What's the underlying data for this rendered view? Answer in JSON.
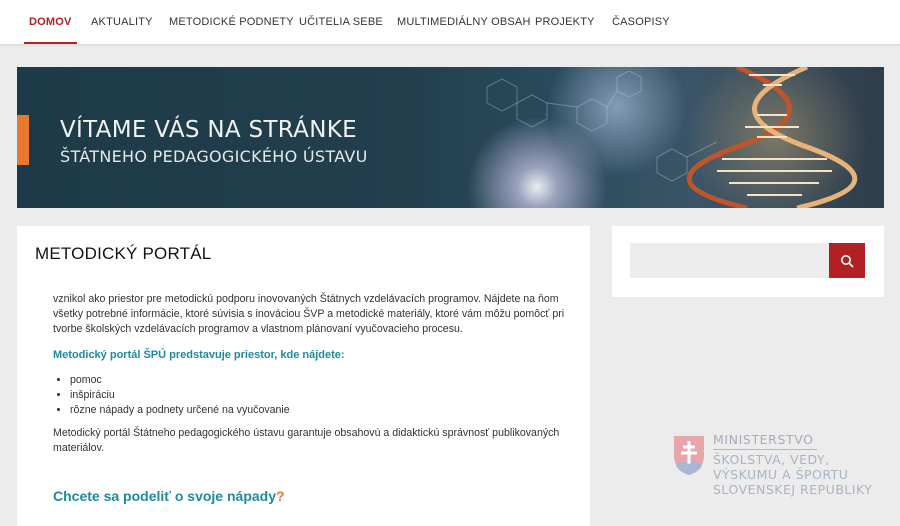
{
  "nav": {
    "items": [
      {
        "label": "DOMOV",
        "active": true
      },
      {
        "label": "AKTUALITY"
      },
      {
        "label": "METODICKÉ PODNETY"
      },
      {
        "label": "UČITELIA SEBE"
      },
      {
        "label": "MULTIMEDIÁLNY OBSAH"
      },
      {
        "label": "PROJEKTY"
      },
      {
        "label": "ČASOPISY"
      }
    ]
  },
  "banner": {
    "title": "VÍTAME VÁS NA STRÁNKE",
    "subtitle": "ŠTÁTNEHO PEDAGOGICKÉHO ÚSTAVU"
  },
  "main": {
    "title": "METODICKÝ PORTÁL",
    "intro": "vznikol ako priestor pre metodickú podporu inovovaných Štátnych vzdelávacích programov. Nájdete na ňom všetky potrebné informácie, ktoré súvisia s inováciou ŠVP a metodické materiály, ktoré vám môžu pomôcť pri tvorbe školských vzdelávacích programov a vlastnom plánovaní vyučovacieho procesu.",
    "highlight": "Metodický portál ŠPÚ predstavuje priestor, kde nájdete:",
    "list": [
      "pomoc",
      "inšpiráciu",
      "rôzne nápady a podnety určené na vyučovanie"
    ],
    "guarantee": "Metodický portál Štátneho pedagogického ústavu garantuje obsahovú a didaktickú správnosť publikovaných materiálov.",
    "share_heading": "Chcete sa podeliť o svoje nápady",
    "share_mark": "?"
  },
  "search": {
    "value": "",
    "placeholder": "",
    "icon": "search-icon"
  },
  "ministry": {
    "line1": "MINISTERSTVO",
    "line2": "ŠKOLSTVA, VEDY,",
    "line3": "VÝSKUMU A ŠPORTU",
    "line4": "SLOVENSKEJ REPUBLIKY"
  },
  "colors": {
    "accent_red": "#b21f24",
    "accent_orange": "#e8782f",
    "teal": "#1e8a9c",
    "background": "#ececec"
  }
}
